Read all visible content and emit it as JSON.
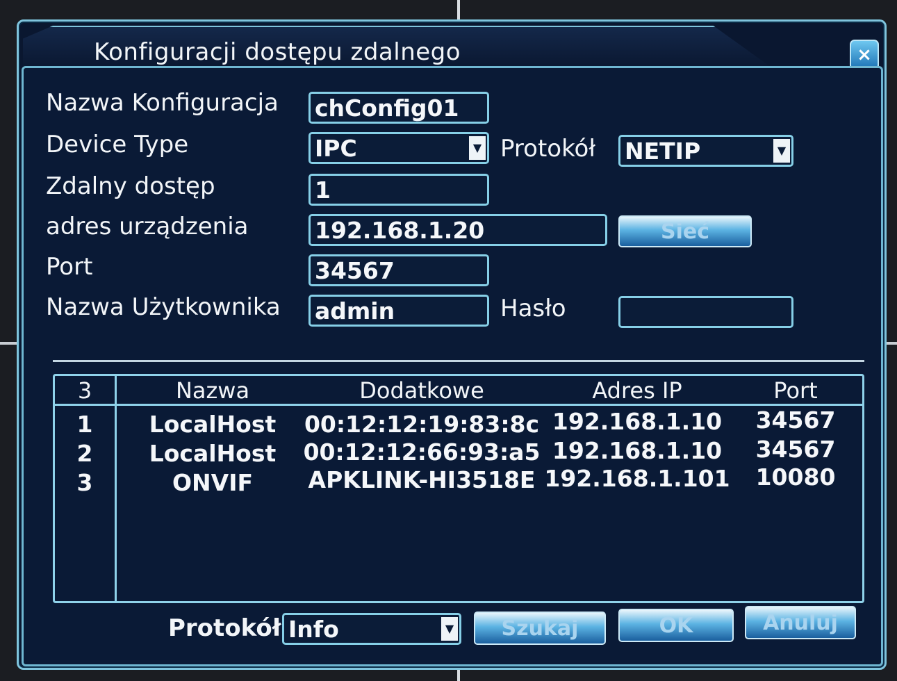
{
  "dialog": {
    "title": "Konfiguracji dostępu zdalnego",
    "close_label": "×"
  },
  "form": {
    "config_name_label": "Nazwa Konfiguracja",
    "config_name_value": "chConfig01",
    "device_type_label": "Device Type",
    "device_type_value": "IPC",
    "protocol_label": "Protokół",
    "protocol_value": "NETIP",
    "remote_access_label": "Zdalny dostęp",
    "remote_access_value": "1",
    "device_address_label": "adres urządzenia",
    "device_address_value": "192.168.1.20",
    "network_button_label": "Sieć",
    "port_label": "Port",
    "port_value": "34567",
    "username_label": "Nazwa Użytkownika",
    "username_value": "admin",
    "password_label": "Hasło",
    "password_value": ""
  },
  "table": {
    "count": "3",
    "headers": [
      "Nazwa",
      "Dodatkowe",
      "Adres IP",
      "Port"
    ],
    "rows": [
      {
        "index": "1",
        "name": "LocalHost",
        "extra": "00:12:12:19:83:8c",
        "ip": "192.168.1.10",
        "port": "34567"
      },
      {
        "index": "2",
        "name": "LocalHost",
        "extra": "00:12:12:66:93:a5",
        "ip": "192.168.1.10",
        "port": "34567"
      },
      {
        "index": "3",
        "name": "ONVIF",
        "extra": "APKLINK-HI3518E",
        "ip": "192.168.1.101",
        "port": "10080"
      }
    ]
  },
  "footer": {
    "protocol_label": "Protokół",
    "protocol_value": "Info",
    "search_button_label": "Szukaj",
    "ok_button_label": "OK",
    "cancel_button_label": "Anuluj"
  }
}
